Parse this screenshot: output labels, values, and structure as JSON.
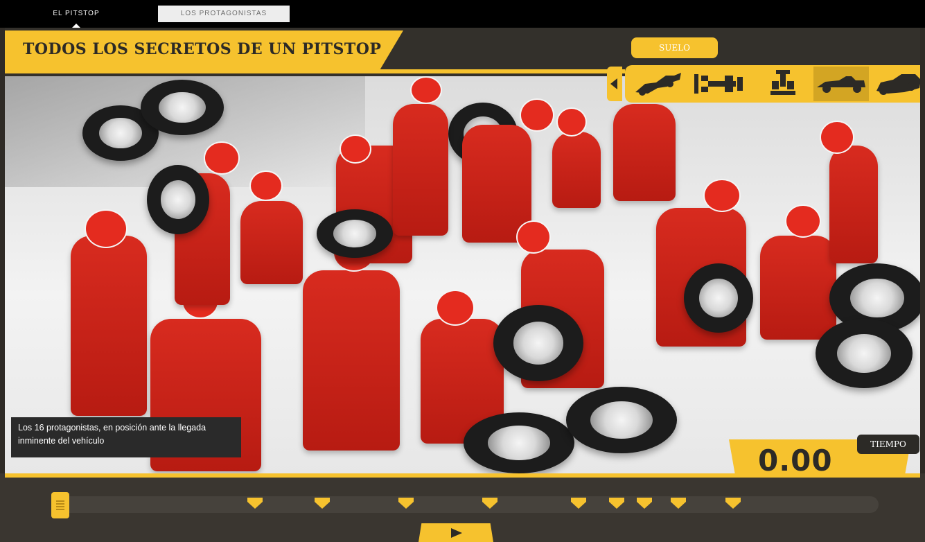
{
  "tabs": {
    "pitstop": "EL PITSTOP",
    "protagonistas": "LOS PROTAGONISTAS"
  },
  "header": {
    "title": "TODOS LOS SECRETOS DE UN PITSTOP"
  },
  "view_panel": {
    "selected_label": "SUELO",
    "views": [
      "car-angle-view",
      "car-top-view",
      "car-front-view",
      "car-side-view",
      "car-rear-angle-view"
    ],
    "active_index": 3
  },
  "caption": {
    "text": "Los 16 protagonistas, en posición ante la llegada inminente del vehículo"
  },
  "timer": {
    "label": "TIEMPO",
    "value": "0.00"
  },
  "timeline": {
    "marker_count": 9,
    "position": 0
  },
  "colors": {
    "accent": "#f6c22e",
    "dark": "#2c2a26",
    "crew_red": "#d82b1f"
  }
}
